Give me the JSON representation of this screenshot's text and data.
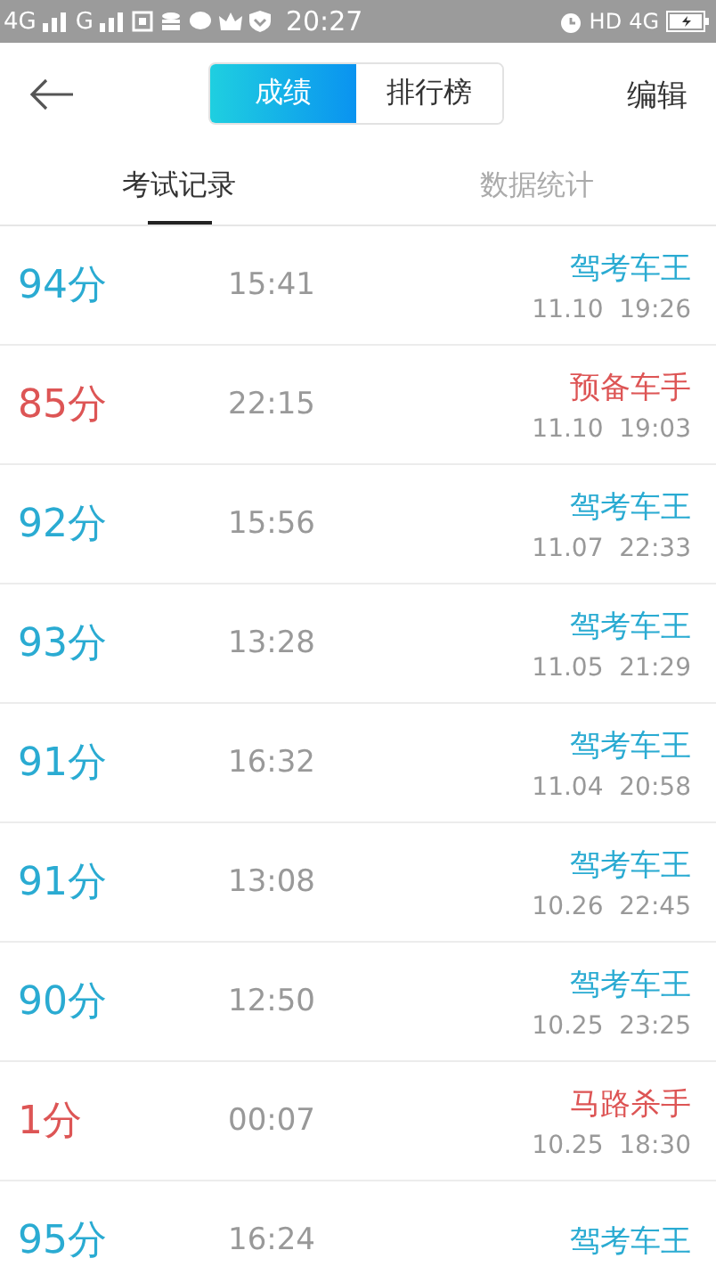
{
  "status_bar": {
    "left": [
      "4G",
      "G"
    ],
    "time": "20:27",
    "right": [
      "HD",
      "4G"
    ]
  },
  "header": {
    "segments": [
      {
        "label": "成绩",
        "selected": true
      },
      {
        "label": "排行榜",
        "selected": false
      }
    ],
    "edit": "编辑"
  },
  "tabs": [
    {
      "label": "考试记录",
      "selected": true
    },
    {
      "label": "数据统计",
      "selected": false
    }
  ],
  "records": [
    {
      "score": "94分",
      "duration": "15:41",
      "title": "驾考车王",
      "date": "11.10  19:26",
      "passed": true
    },
    {
      "score": "85分",
      "duration": "22:15",
      "title": "预备车手",
      "date": "11.10  19:03",
      "passed": false
    },
    {
      "score": "92分",
      "duration": "15:56",
      "title": "驾考车王",
      "date": "11.07  22:33",
      "passed": true
    },
    {
      "score": "93分",
      "duration": "13:28",
      "title": "驾考车王",
      "date": "11.05  21:29",
      "passed": true
    },
    {
      "score": "91分",
      "duration": "16:32",
      "title": "驾考车王",
      "date": "11.04  20:58",
      "passed": true
    },
    {
      "score": "91分",
      "duration": "13:08",
      "title": "驾考车王",
      "date": "10.26  22:45",
      "passed": true
    },
    {
      "score": "90分",
      "duration": "12:50",
      "title": "驾考车王",
      "date": "10.25  23:25",
      "passed": true
    },
    {
      "score": "1分",
      "duration": "00:07",
      "title": "马路杀手",
      "date": "10.25  18:30",
      "passed": false
    },
    {
      "score": "95分",
      "duration": "16:24",
      "title": "驾考车王",
      "passed": true
    }
  ]
}
